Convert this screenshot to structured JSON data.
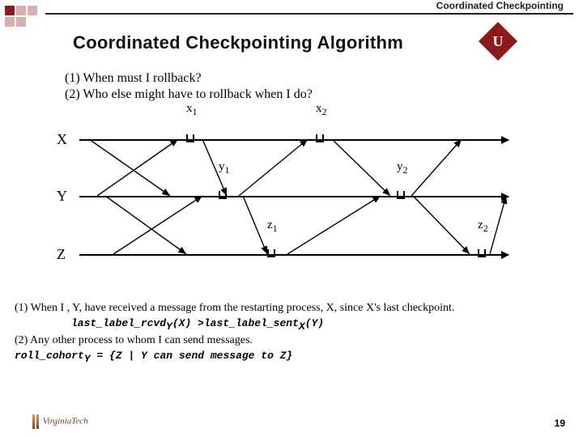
{
  "header": {
    "small": "Coordinated Checkpointing",
    "title": "Coordinated Checkpointing Algorithm",
    "badge": "U"
  },
  "questions": {
    "q1": "(1) When must I rollback?",
    "q2": "(2) Who else might have to rollback when I do?"
  },
  "labels": {
    "x1_base": "x",
    "x1_sub": "1",
    "x2_base": "x",
    "x2_sub": "2",
    "y1_base": "y",
    "y1_sub": "1",
    "y2_base": "y",
    "y2_sub": "2",
    "z1_base": "z",
    "z1_sub": "1",
    "z2_base": "z",
    "z2_sub": "2",
    "X": "X",
    "Y": "Y",
    "Z": "Z"
  },
  "chart_data": {
    "type": "diagram",
    "processes": [
      "X",
      "Y",
      "Z"
    ],
    "checkpoints": {
      "X": [
        "x1",
        "x2"
      ],
      "Y": [
        "y1",
        "y2"
      ],
      "Z": [
        "z1",
        "z2"
      ]
    },
    "messages": [
      {
        "from": "X",
        "to": "Y",
        "start_after": "start",
        "end_before": "y1"
      },
      {
        "from": "Y",
        "to": "X",
        "start_after": "start",
        "end_before": "x1"
      },
      {
        "from": "X",
        "to": "Y",
        "start_after": "x1",
        "end_before": "y1"
      },
      {
        "from": "Y",
        "to": "X",
        "start_after": "y1",
        "end_before": "x2"
      },
      {
        "from": "X",
        "to": "Y",
        "start_after": "x2",
        "end_before": "y2"
      },
      {
        "from": "Y",
        "to": "X",
        "start_after": "y2",
        "end_before": "end"
      },
      {
        "from": "Y",
        "to": "Z",
        "start_after": "start",
        "end_before": "z1"
      },
      {
        "from": "Z",
        "to": "Y",
        "start_after": "start",
        "end_before": "y1"
      },
      {
        "from": "Y",
        "to": "Z",
        "start_after": "y1",
        "end_before": "z1"
      },
      {
        "from": "Z",
        "to": "Y",
        "start_after": "z1",
        "end_before": "y2"
      },
      {
        "from": "Y",
        "to": "Z",
        "start_after": "y2",
        "end_before": "z2"
      },
      {
        "from": "Z",
        "to": "Y",
        "start_after": "z2",
        "end_before": "end"
      }
    ]
  },
  "footer": {
    "line1": "(1) When I , Y, have received a message from the restarting process, X, since X's last checkpoint.",
    "code1a": "last_label_rcvd",
    "code1a_sub": "Y",
    "code1a_tail": "(X) >",
    "code1b": "last_label_sent",
    "code1b_sub": "X",
    "code1b_tail": "(Y)",
    "line2": "(2) Any other process to whom I can send messages.",
    "code2a": "roll_cohort",
    "code2a_sub": "Y",
    "code2a_tail": " = {Z | Y can send message to Z}"
  },
  "page": {
    "vt": "VirginiaTech",
    "num": "19"
  }
}
